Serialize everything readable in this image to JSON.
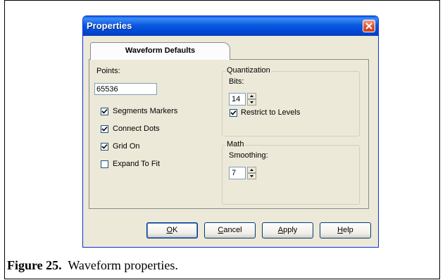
{
  "dialog": {
    "title": "Properties",
    "close_icon": "close-x-icon",
    "tab_label": "Waveform Defaults"
  },
  "left": {
    "points_label": "Points:",
    "points_value": "65536",
    "checkboxes": [
      {
        "label": "Segments Markers",
        "checked": true
      },
      {
        "label": "Connect Dots",
        "checked": true
      },
      {
        "label": "Grid On",
        "checked": true
      },
      {
        "label": "Expand To Fit",
        "checked": false
      }
    ]
  },
  "quantization": {
    "title": "Quantization",
    "bits_label": "Bits:",
    "bits_value": "14",
    "restrict_label": "Restrict to Levels",
    "restrict_checked": true
  },
  "math": {
    "title": "Math",
    "smoothing_label": "Smoothing:",
    "smoothing_value": "7"
  },
  "buttons": {
    "ok_key": "O",
    "ok_rest": "K",
    "cancel_key": "C",
    "cancel_rest": "ancel",
    "apply_key": "A",
    "apply_rest": "pply",
    "help_key": "H",
    "help_rest": "elp"
  },
  "caption": {
    "label": "Figure 25.",
    "text": "Waveform properties."
  }
}
